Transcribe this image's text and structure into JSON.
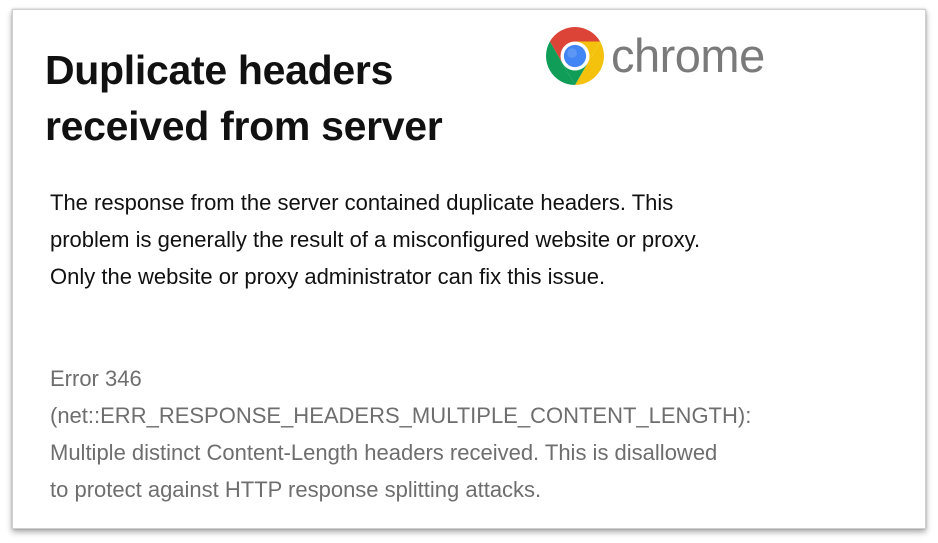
{
  "page": {
    "title_lines": [
      "Duplicate headers",
      "received from server"
    ],
    "logo": {
      "icon": "chrome-logo-icon",
      "wordmark": "chrome",
      "colors": {
        "red": "#db4437",
        "yellow": "#f4c20d",
        "green": "#0f9d58",
        "blue": "#4285f4",
        "wordmark": "#7a7a7a"
      }
    },
    "description_lines": [
      "The response from the server contained duplicate headers. This",
      "problem is generally the result of a misconfigured website or proxy.",
      "Only the website or proxy administrator can fix this issue."
    ],
    "error_lines": [
      "Error 346",
      "(net::ERR_RESPONSE_HEADERS_MULTIPLE_CONTENT_LENGTH):",
      "Multiple distinct Content-Length headers received. This is disallowed",
      "to protect against HTTP response splitting attacks."
    ]
  }
}
